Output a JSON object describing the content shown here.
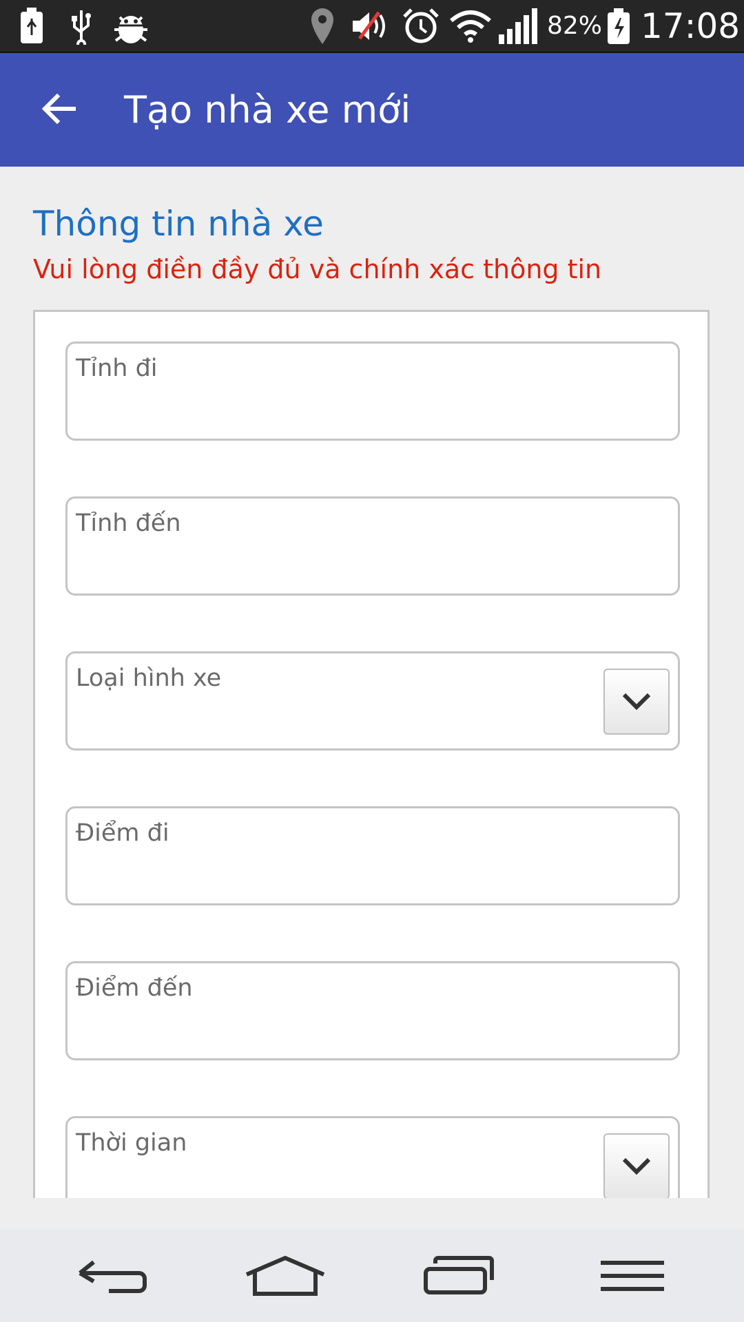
{
  "status_bar": {
    "battery_percent": "82%",
    "time": "17:08",
    "icons": [
      "battery-saver-icon",
      "usb-icon",
      "debug-bug-icon",
      "location-icon",
      "volume-muted-icon",
      "alarm-icon",
      "wifi-icon",
      "signal-icon",
      "battery-charging-icon"
    ]
  },
  "app_bar": {
    "title": "Tạo nhà xe mới",
    "back_icon": "arrow-back-icon"
  },
  "section": {
    "title": "Thông tin nhà xe",
    "subtitle": "Vui lòng điền đầy đủ và chính xác thông tin"
  },
  "form": {
    "fields": [
      {
        "label": "Tỉnh đi",
        "type": "text"
      },
      {
        "label": "Tỉnh đến",
        "type": "text"
      },
      {
        "label": "Loại hình xe",
        "type": "select"
      },
      {
        "label": "Điểm đi",
        "type": "text"
      },
      {
        "label": "Điểm đến",
        "type": "text"
      },
      {
        "label": "Thời gian",
        "type": "select"
      }
    ]
  },
  "nav_bar": {
    "icons": [
      "back-nav-icon",
      "home-icon",
      "recent-apps-icon",
      "menu-icon"
    ]
  },
  "colors": {
    "app_bar": "#3f51b5",
    "section_title": "#1e6fc4",
    "section_subtitle": "#d9230f",
    "status_bar": "#262626"
  }
}
